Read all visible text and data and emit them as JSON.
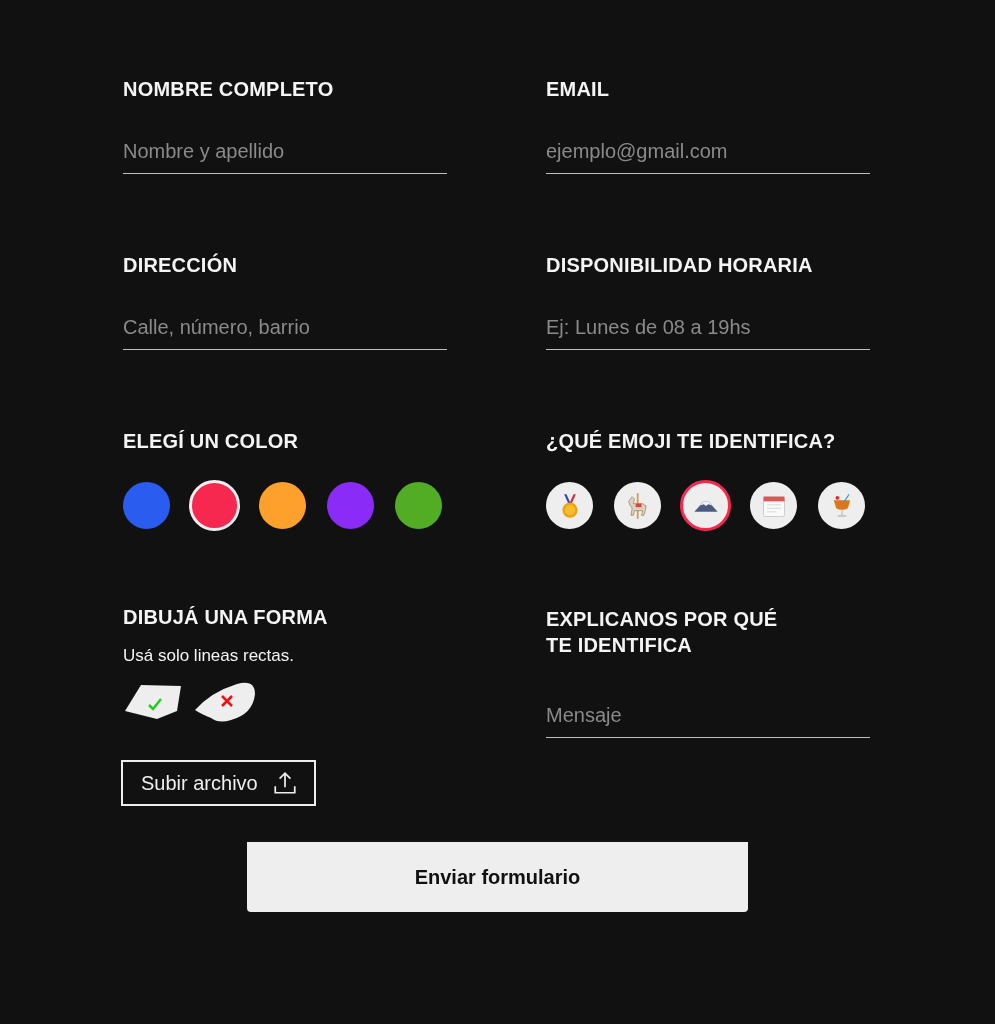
{
  "fields": [
    {
      "label": "NOMBRE COMPLETO",
      "placeholder": "Nombre y apellido"
    },
    {
      "label": "EMAIL",
      "placeholder": "ejemplo@gmail.com"
    },
    {
      "label": "DIRECCIÓN",
      "placeholder": "Calle, número, barrio"
    },
    {
      "label": "DISPONIBILIDAD HORARIA",
      "placeholder": "Ej: Lunes de 08 a 19hs"
    }
  ],
  "color_picker": {
    "label": "ELEGÍ UN COLOR",
    "colors": [
      {
        "color": "#2b5cf0",
        "selected": false
      },
      {
        "color": "#f7284f",
        "selected": true
      },
      {
        "color": "#fda12c",
        "selected": false
      },
      {
        "color": "#8b2bf7",
        "selected": false
      },
      {
        "color": "#52ad25",
        "selected": false
      }
    ]
  },
  "emoji_picker": {
    "label": "¿QUÉ EMOJI TE IDENTIFICA?",
    "emojis": [
      {
        "kind": "medal",
        "selected": false
      },
      {
        "kind": "horse",
        "selected": false
      },
      {
        "kind": "mountain",
        "selected": true
      },
      {
        "kind": "calendar",
        "selected": false
      },
      {
        "kind": "cocktail",
        "selected": false
      }
    ]
  },
  "shape": {
    "label": "DIBUJÁ UNA FORMA",
    "hint": "Usá solo lineas rectas.",
    "upload_button": "Subir archivo"
  },
  "explain": {
    "label_lines": [
      "EXPLICANOS POR QUÉ",
      "TE IDENTIFICA"
    ],
    "placeholder": "Mensaje"
  },
  "submit_button": "Enviar formulario"
}
